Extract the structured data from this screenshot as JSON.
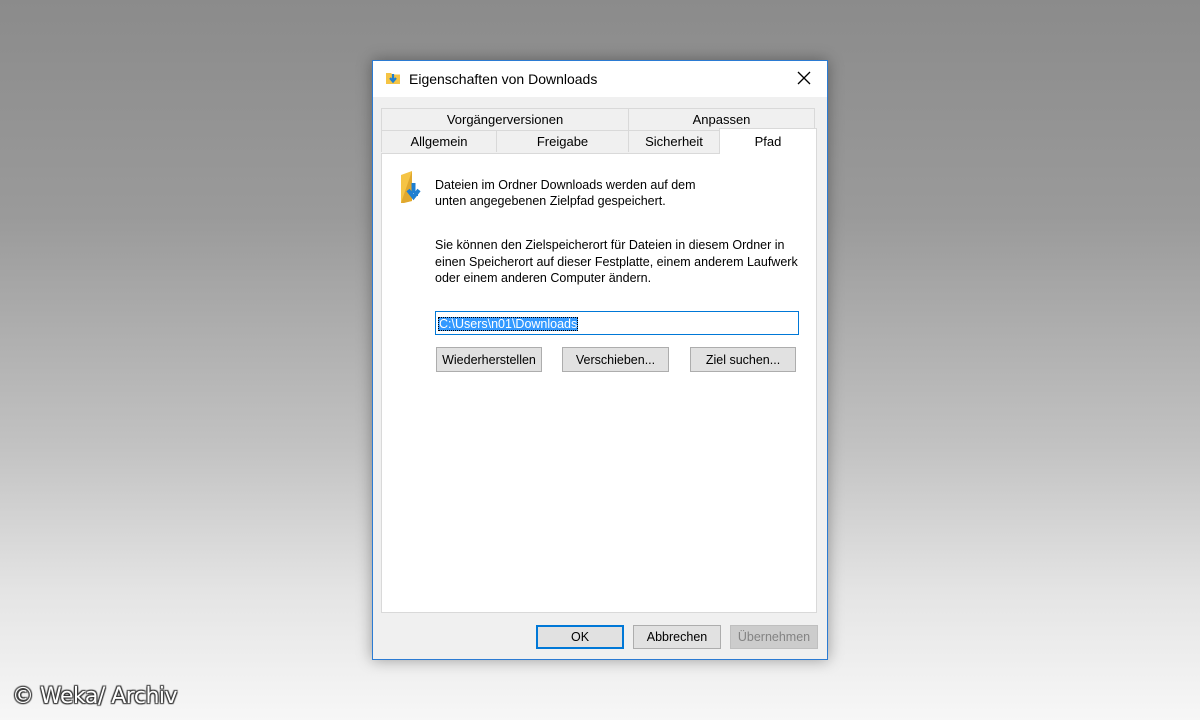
{
  "dialog": {
    "title": "Eigenschaften von Downloads",
    "tabs_top": [
      "Vorgängerversionen",
      "Anpassen"
    ],
    "tabs_bottom": [
      "Allgemein",
      "Freigabe",
      "Sicherheit",
      "Pfad"
    ],
    "active_tab": "Pfad",
    "info_line1": "Dateien im Ordner Downloads werden auf dem",
    "info_line2": "unten angegebenen Zielpfad gespeichert.",
    "desc_line1": "Sie können den Zielspeicherort für Dateien in diesem Ordner in",
    "desc_line2": "einen Speicherort auf dieser Festplatte, einem anderem Laufwerk",
    "desc_line3": "oder einem anderen Computer ändern.",
    "path_value": "C:\\Users\\n01\\Downloads",
    "buttons": {
      "restore": "Wiederherstellen",
      "move": "Verschieben...",
      "find_target": "Ziel suchen..."
    },
    "footer": {
      "ok": "OK",
      "cancel": "Abbrechen",
      "apply": "Übernehmen"
    }
  },
  "watermark": "© Weka/ Archiv",
  "colors": {
    "accent": "#0078d7",
    "selection": "#3399ff",
    "folder": "#f5c445",
    "arrow": "#1f7fd1"
  },
  "icons": {
    "title_icon": "downloads-folder-icon",
    "close": "close-icon",
    "panel_icon": "downloads-folder-icon"
  }
}
